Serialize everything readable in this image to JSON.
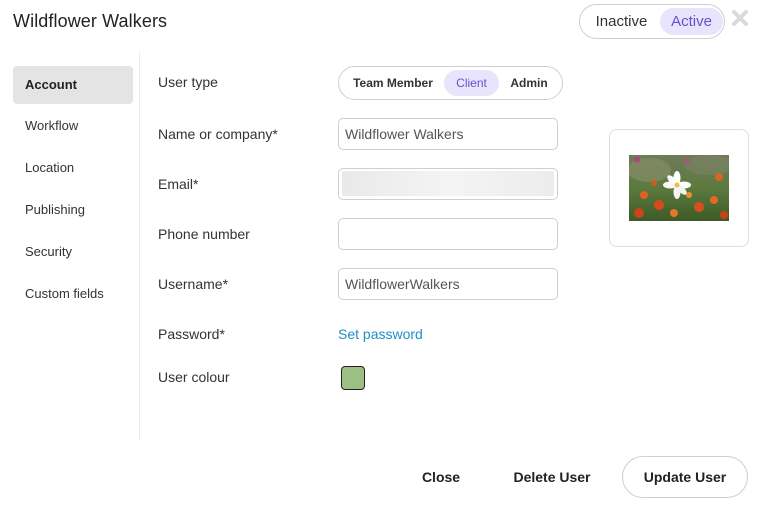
{
  "dialog": {
    "title": "Wildflower Walkers"
  },
  "status": {
    "inactive_label": "Inactive",
    "active_label": "Active",
    "selected": "Active"
  },
  "sidebar": {
    "items": [
      {
        "label": "Account",
        "active": true
      },
      {
        "label": "Workflow"
      },
      {
        "label": "Location"
      },
      {
        "label": "Publishing"
      },
      {
        "label": "Security"
      },
      {
        "label": "Custom fields"
      }
    ]
  },
  "form": {
    "user_type": {
      "label": "User type",
      "options": [
        "Team Member",
        "Client",
        "Admin"
      ],
      "selected": "Client"
    },
    "name": {
      "label": "Name or company*",
      "value": "Wildflower Walkers"
    },
    "email": {
      "label": "Email*",
      "value": ""
    },
    "phone": {
      "label": "Phone number",
      "value": ""
    },
    "username": {
      "label": "Username*",
      "value": "WildflowerWalkers"
    },
    "password": {
      "label": "Password*",
      "link": "Set password"
    },
    "colour": {
      "label": "User colour",
      "value": "#9cc083"
    }
  },
  "avatar": {
    "icon": "flower-photo"
  },
  "footer": {
    "close_label": "Close",
    "delete_label": "Delete User",
    "update_label": "Update User"
  },
  "colors": {
    "accent": "#6a4fd3",
    "accent_bg": "#e8e4fb",
    "link": "#1f8fc6"
  }
}
